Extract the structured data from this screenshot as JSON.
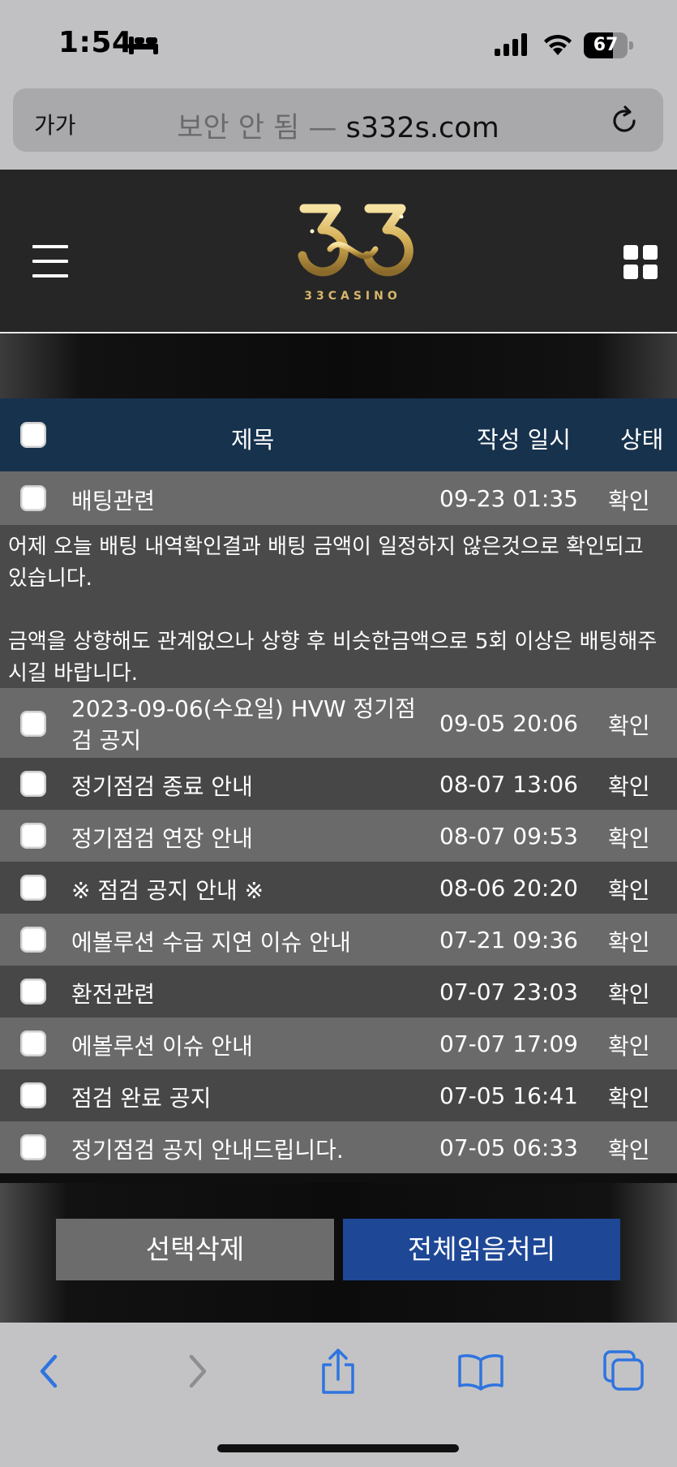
{
  "status_bar": {
    "time": "1:54",
    "battery": "67",
    "battery_level": 0.67
  },
  "url_bar": {
    "aa": "가가",
    "insecure_label": "보안 안 됨 —",
    "domain": "s332s.com"
  },
  "table": {
    "headers": {
      "title": "제목",
      "date": "작성 일시",
      "status": "상태"
    },
    "first_row": {
      "title": "배팅관련",
      "date": "09-23 01:35",
      "status": "확인"
    },
    "message": {
      "para1": "어제 오늘 배팅 내역확인결과 배팅 금액이 일정하지 않은것으로 확인되고 있습니다.",
      "para2": "금액을 상향해도 관계없으나 상향 후 비슷한금액으로 5회 이상은 배팅해주시길 바랍니다."
    },
    "rows": [
      {
        "title": "2023-09-06(수요일) HVW 정기점검 공지",
        "date": "09-05 20:06",
        "status": "확인"
      },
      {
        "title": "정기점검 종료 안내",
        "date": "08-07 13:06",
        "status": "확인"
      },
      {
        "title": "정기점검 연장 안내",
        "date": "08-07 09:53",
        "status": "확인"
      },
      {
        "title": "※ 점검 공지 안내 ※",
        "date": "08-06 20:20",
        "status": "확인"
      },
      {
        "title": "에볼루션 수급 지연 이슈 안내",
        "date": "07-21 09:36",
        "status": "확인"
      },
      {
        "title": "환전관련",
        "date": "07-07 23:03",
        "status": "확인"
      },
      {
        "title": "에볼루션 이슈 안내",
        "date": "07-07 17:09",
        "status": "확인"
      },
      {
        "title": "점검 완료 공지",
        "date": "07-05 16:41",
        "status": "확인"
      },
      {
        "title": "정기점검 공지 안내드립니다.",
        "date": "07-05 06:33",
        "status": "확인"
      }
    ]
  },
  "buttons": {
    "delete_selected": "선택삭제",
    "mark_all_read": "전체읽음처리"
  },
  "logo": {
    "text": "33CASINO"
  },
  "colors": {
    "header_bg": "#17324d",
    "accent_blue": "#1e4796",
    "gold": "#d7b76a",
    "ios_blue": "#2f74e0"
  }
}
